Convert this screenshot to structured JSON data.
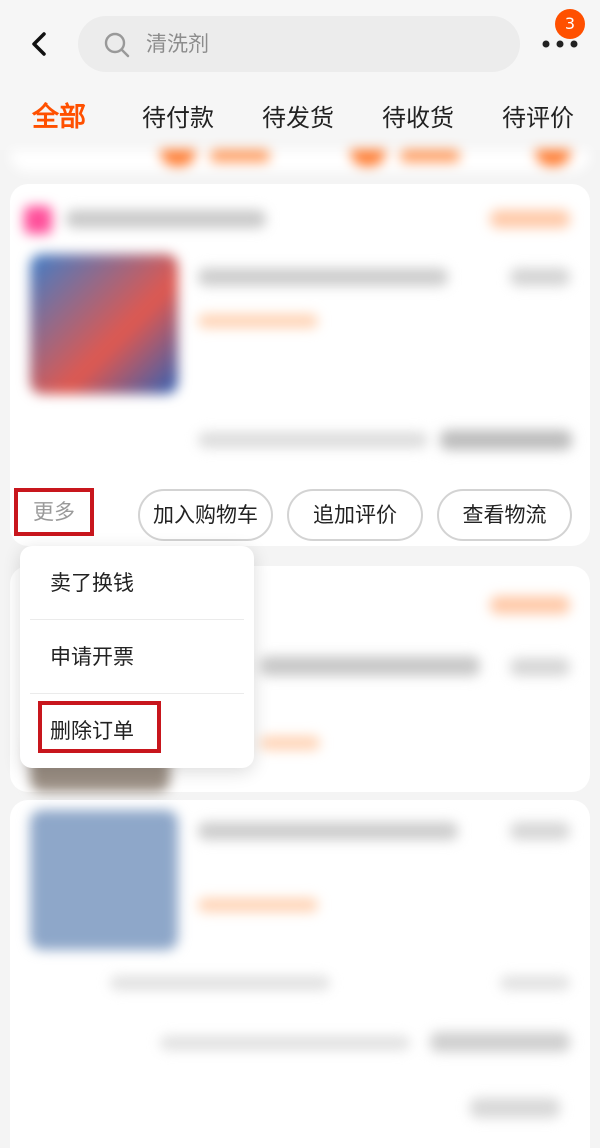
{
  "search": {
    "text": "清洗剂"
  },
  "header": {
    "badge_count": "3",
    "icons": [
      "back-arrow-icon",
      "search-icon",
      "more-dots-icon"
    ]
  },
  "tabs": [
    {
      "label": "全部",
      "active": true
    },
    {
      "label": "待付款",
      "active": false
    },
    {
      "label": "待发货",
      "active": false
    },
    {
      "label": "待收货",
      "active": false
    },
    {
      "label": "待评价",
      "active": false
    }
  ],
  "order": {
    "more_label": "更多",
    "actions": [
      "加入购物车",
      "追加评价",
      "查看物流"
    ]
  },
  "more_menu": {
    "items": [
      "卖了换钱",
      "申请开票",
      "删除订单"
    ],
    "highlighted_item": "删除订单"
  },
  "colors": {
    "accent": "#ff5000",
    "annotation": "#c8161d"
  }
}
